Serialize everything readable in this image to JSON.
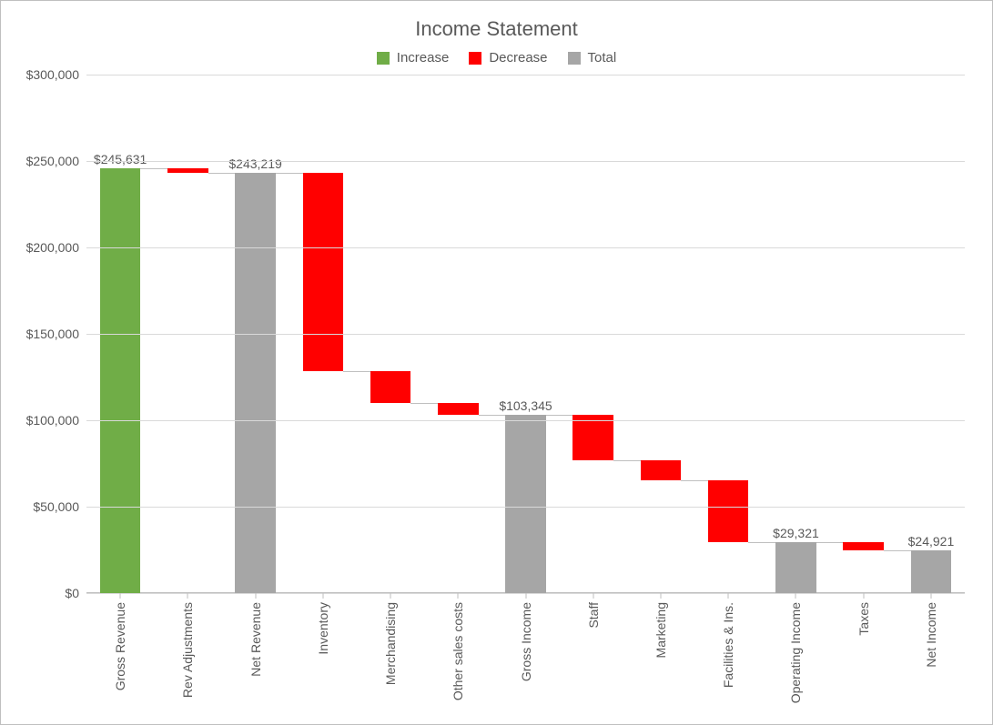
{
  "chart_data": {
    "type": "bar",
    "subtype": "waterfall",
    "title": "Income Statement",
    "legend": {
      "increase": "Increase",
      "decrease": "Decrease",
      "total": "Total"
    },
    "y": {
      "min": 0,
      "max": 300000,
      "step": 50000,
      "fmt": "$#,##0"
    },
    "items": [
      {
        "name": "Gross Revenue",
        "type": "increase",
        "delta": 245631,
        "start": 0,
        "end": 245631,
        "label": "$245,631"
      },
      {
        "name": "Rev Adjustments",
        "type": "decrease",
        "delta": -2412,
        "start": 245631,
        "end": 243219
      },
      {
        "name": "Net Revenue",
        "type": "total",
        "end": 243219,
        "label": "$243,219"
      },
      {
        "name": "Inventory",
        "type": "decrease",
        "delta": -114899,
        "start": 243219,
        "end": 128320
      },
      {
        "name": "Merchandising",
        "type": "decrease",
        "delta": -18500,
        "start": 128320,
        "end": 109820
      },
      {
        "name": "Other sales costs",
        "type": "decrease",
        "delta": -6475,
        "start": 109820,
        "end": 103345
      },
      {
        "name": "Gross Income",
        "type": "total",
        "end": 103345,
        "label": "$103,345"
      },
      {
        "name": "Staff",
        "type": "decrease",
        "delta": -26745,
        "start": 103345,
        "end": 76600
      },
      {
        "name": "Marketing",
        "type": "decrease",
        "delta": -11279,
        "start": 76600,
        "end": 65321
      },
      {
        "name": "Facilities & Ins.",
        "type": "decrease",
        "delta": -36000,
        "start": 65321,
        "end": 29321
      },
      {
        "name": "Operating Income",
        "type": "total",
        "end": 29321,
        "label": "$29,321"
      },
      {
        "name": "Taxes",
        "type": "decrease",
        "delta": -4400,
        "start": 29321,
        "end": 24921
      },
      {
        "name": "Net Income",
        "type": "total",
        "end": 24921,
        "label": "$24,921"
      }
    ]
  },
  "colors": {
    "increase": "#70AD47",
    "decrease": "#FF0000",
    "total": "#A6A6A6"
  }
}
